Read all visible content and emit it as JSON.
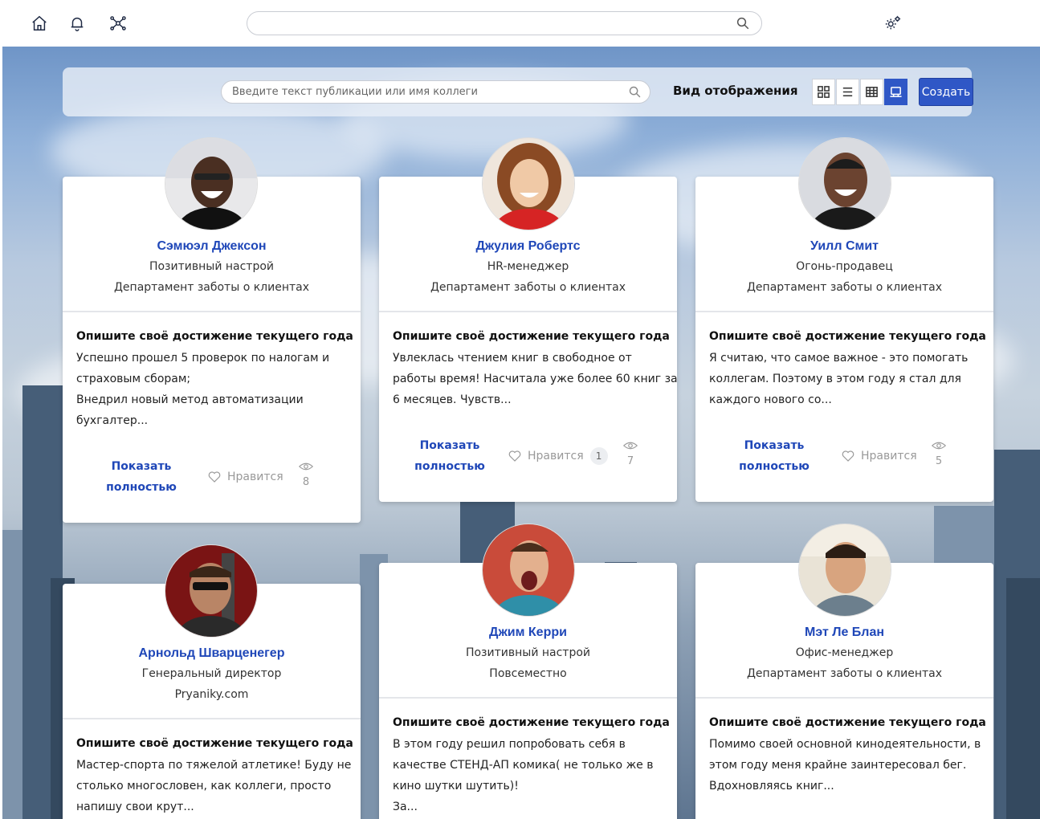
{
  "topbar": {
    "icons": [
      "home-icon",
      "bell-icon",
      "network-icon",
      "settings-icon"
    ],
    "search_value": ""
  },
  "feed": {
    "search_placeholder": "Введите текст публикации или имя коллеги",
    "view_label": "Вид отображения",
    "view_modes": [
      "tiles-view-icon",
      "list-view-icon",
      "table-view-icon",
      "cards-view-icon"
    ],
    "active_view": "cards-view-icon",
    "create_label": "Создать"
  },
  "theme": {
    "accent": "#2f57c6",
    "name_color": "#1f47b8"
  },
  "cards": [
    {
      "name": "Сэмюэл Джексон",
      "line1": "Позитивный настрой",
      "line2": "Департамент заботы о клиентах",
      "question": "Опишите своё достижение текущего года",
      "body": [
        "Успешно прошел 5 проверок по налогам и",
        "страховым сборам;",
        "Внедрил новый метод автоматизации",
        "бухгалтер..."
      ],
      "show_full": [
        "Показать",
        "полностью"
      ],
      "like_label": "Нравится",
      "likes": null,
      "views": "8"
    },
    {
      "name": "Джулия Робертс",
      "line1": "HR-менеджер",
      "line2": "Департамент заботы о клиентах",
      "question": "Опишите своё достижение текущего года",
      "body": [
        "Увлеклась чтением книг в свободное от",
        "работы время! Насчитала уже более 60 книг за",
        "6 месяцев. Чувств..."
      ],
      "show_full": [
        "Показать",
        "полностью"
      ],
      "like_label": "Нравится",
      "likes": "1",
      "views": "7"
    },
    {
      "name": "Уилл Смит",
      "line1": "Огонь-продавец",
      "line2": "Департамент заботы о клиентах",
      "question": "Опишите своё достижение текущего года",
      "body": [
        "Я считаю, что самое важное - это помогать",
        "коллегам. Поэтому в этом году я стал для",
        "каждого нового со..."
      ],
      "show_full": [
        "Показать",
        "полностью"
      ],
      "like_label": "Нравится",
      "likes": null,
      "views": "5"
    },
    {
      "name": "Арнольд Шварценегер",
      "line1": "Генеральный директор",
      "line2": "Pryaniky.com",
      "question": "Опишите своё достижение текущего года",
      "body": [
        "Мастер-спорта по тяжелой атлетике! Буду не",
        "столько многословен, как коллеги, просто",
        "напишу свои крут..."
      ]
    },
    {
      "name": "Джим Керри",
      "line1": "Позитивный настрой",
      "line2": "Повсеместно",
      "question": "Опишите своё достижение текущего года",
      "body": [
        "В этом году решил попробовать себя в",
        "качестве СТЕНД-АП комика( не только же в",
        "кино шутки шутить)!",
        "За..."
      ]
    },
    {
      "name": "Мэт Ле Блан",
      "line1": "Офис-менеджер",
      "line2": "Департамент заботы о клиентах",
      "question": "Опишите своё достижение текущего года",
      "body": [
        "Помимо своей основной кинодеятельности, в",
        "этом году меня крайне заинтересовал бег.",
        "Вдохновляясь книг..."
      ]
    }
  ]
}
